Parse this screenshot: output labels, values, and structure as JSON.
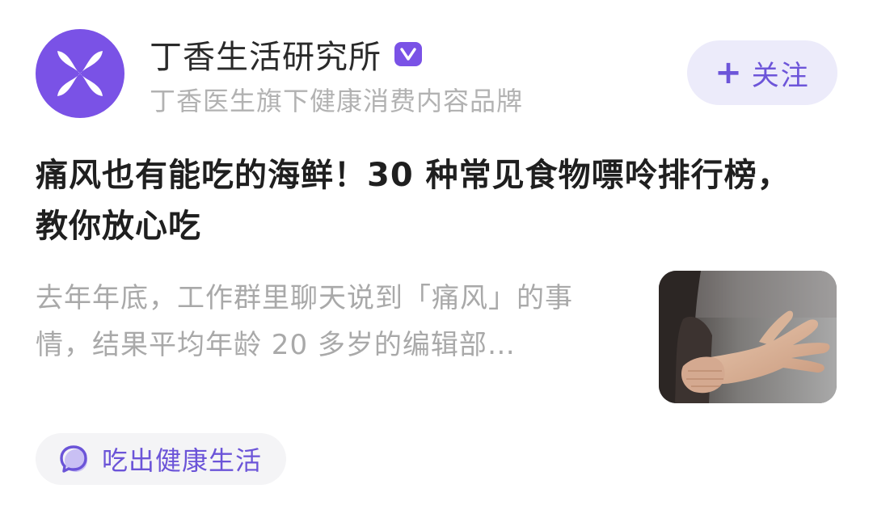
{
  "account": {
    "name": "丁香生活研究所",
    "verified_mark": "V",
    "description": "丁香医生旗下健康消费内容品牌",
    "avatar_icon": "flower-petal-logo-icon"
  },
  "follow": {
    "icon": "plus-icon",
    "plus": "+",
    "label": "关注"
  },
  "article": {
    "title": "痛风也有能吃的海鲜！30 种常见食物嘌呤排行榜，教你放心吃",
    "excerpt": "去年年底，工作群里聊天说到「痛风」的事情，结果平均年龄 20 多岁的编辑部…",
    "thumbnail": "hand-holding-wrist-photo"
  },
  "topic": {
    "icon": "speech-bubble-icon",
    "label": "吃出健康生活"
  },
  "colors": {
    "accent": "#7a52e6",
    "follow_bg": "#ecebfa",
    "tag_bg": "#f4f4f6",
    "title_text": "#1f1f1f",
    "muted_text": "#a9a9a9"
  }
}
